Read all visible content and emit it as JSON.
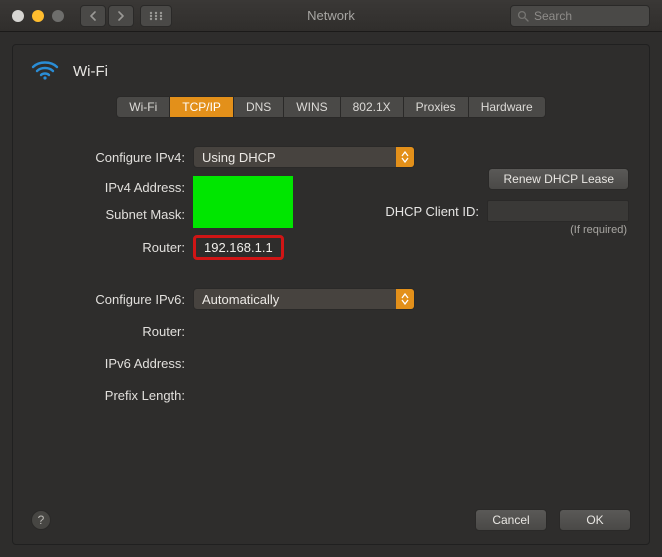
{
  "window": {
    "title": "Network"
  },
  "search": {
    "placeholder": "Search"
  },
  "header": {
    "name": "Wi-Fi"
  },
  "tabs": {
    "items": [
      "Wi-Fi",
      "TCP/IP",
      "DNS",
      "WINS",
      "802.1X",
      "Proxies",
      "Hardware"
    ],
    "active_index": 1
  },
  "form": {
    "configure_ipv4_label": "Configure IPv4:",
    "configure_ipv4_value": "Using DHCP",
    "ipv4_address_label": "IPv4 Address:",
    "subnet_mask_label": "Subnet Mask:",
    "router_label": "Router:",
    "router_value": "192.168.1.1",
    "configure_ipv6_label": "Configure IPv6:",
    "configure_ipv6_value": "Automatically",
    "router6_label": "Router:",
    "ipv6_address_label": "IPv6 Address:",
    "prefix_length_label": "Prefix Length:"
  },
  "side": {
    "renew_label": "Renew DHCP Lease",
    "dhcp_client_id_label": "DHCP Client ID:",
    "dhcp_client_id_value": "",
    "dhcp_note": "(If required)"
  },
  "footer": {
    "help": "?",
    "cancel": "Cancel",
    "ok": "OK"
  }
}
